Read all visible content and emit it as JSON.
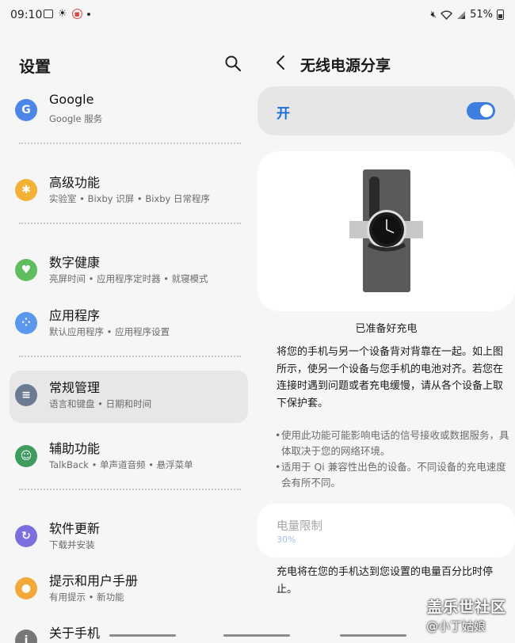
{
  "status_bar": {
    "time": "09:10",
    "battery": "51%"
  },
  "left": {
    "title": "设置",
    "items": [
      {
        "title": "Google",
        "sub": "Google 服务",
        "icon": "google-icon",
        "color": "#4c86e8",
        "glyph": "G"
      },
      {
        "title": "高级功能",
        "sub": "实验室 • Bixby 识屏 • Bixby 日常程序",
        "icon": "advanced-features-icon",
        "color": "#f3b236",
        "glyph": "✱"
      },
      {
        "title": "数字健康",
        "sub": "亮屏时间 • 应用程序定时器 • 就寝模式",
        "icon": "digital-wellbeing-icon",
        "color": "#5fbd5f",
        "glyph": "♥"
      },
      {
        "title": "应用程序",
        "sub": "默认应用程序 • 应用程序设置",
        "icon": "apps-icon",
        "color": "#5c97ee",
        "glyph": "⁘"
      },
      {
        "title": "常规管理",
        "sub": "语言和键盘 • 日期和时间",
        "icon": "general-management-icon",
        "color": "#6c7b92",
        "glyph": "≡"
      },
      {
        "title": "辅助功能",
        "sub": "TalkBack • 单声道音频 • 悬浮菜单",
        "icon": "accessibility-icon",
        "color": "#3f9c5f",
        "glyph": "☺"
      },
      {
        "title": "软件更新",
        "sub": "下载并安装",
        "icon": "software-update-icon",
        "color": "#7a6fdc",
        "glyph": "↻"
      },
      {
        "title": "提示和用户手册",
        "sub": "有用提示 • 新功能",
        "icon": "tips-icon",
        "color": "#f3a93a",
        "glyph": "●"
      },
      {
        "title": "关于手机",
        "sub": "",
        "icon": "about-phone-icon",
        "color": "#777777",
        "glyph": "i"
      }
    ]
  },
  "right": {
    "title": "无线电源分享",
    "toggle_label": "开",
    "toggle_on": true,
    "ready_text": "已准备好充电",
    "description": "将您的手机与另一个设备背对背靠在一起。如上图所示，使另一个设备与您手机的电池对齐。若您在连接时遇到问题或者充电缓慢，请从各个设备上取下保护套。",
    "bullets": [
      "使用此功能可能影响电话的信号接收或数据服务，具体取决于您的网络环境。",
      "适用于 Qi 兼容性出色的设备。不同设备的充电速度会有所不同。"
    ],
    "limit_title": "电量限制",
    "limit_value": "30%",
    "limit_description": "充电将在您的手机达到您设置的电量百分比时停止。"
  },
  "watermark": {
    "line1": "盖乐世社区",
    "line2": "@小丁姑娘"
  },
  "colors": {
    "accent": "#3d7fe0",
    "background": "#f6f6f6"
  }
}
